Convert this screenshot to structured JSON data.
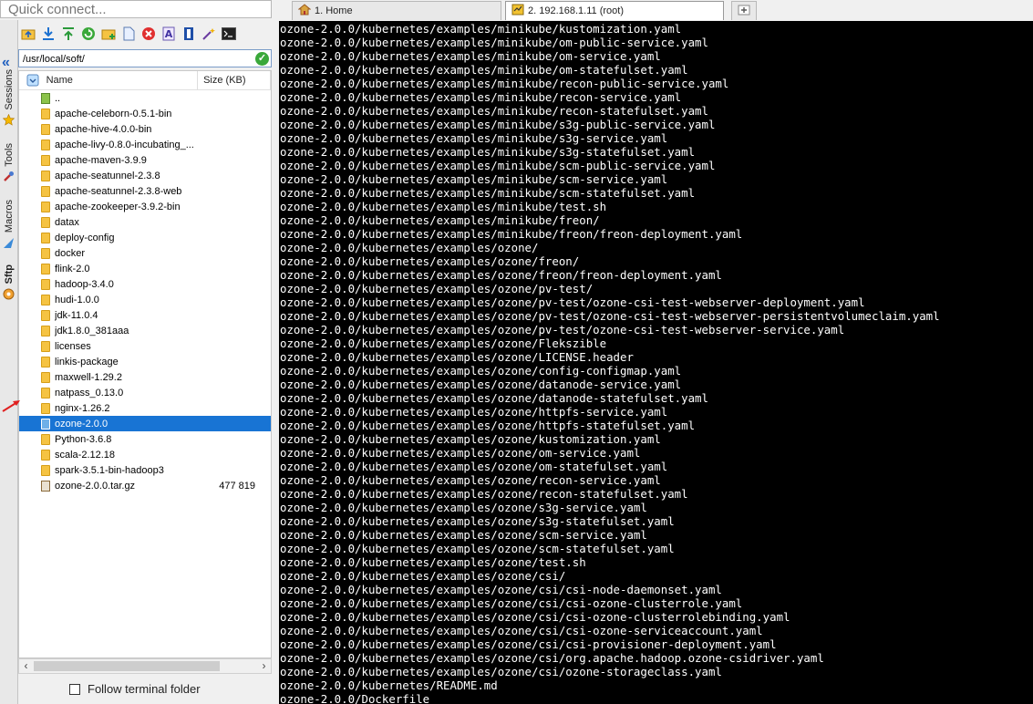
{
  "quick_connect": {
    "placeholder": "Quick connect..."
  },
  "tabs": [
    {
      "label": "1. Home",
      "icon": "home-icon"
    },
    {
      "label": "2. 192.168.1.11 (root)",
      "icon": "ssh-icon"
    }
  ],
  "side_tabs": [
    {
      "label": "Sessions",
      "icon": "star-icon"
    },
    {
      "label": "Tools",
      "icon": "tools-icon"
    },
    {
      "label": "Macros",
      "icon": "macro-icon"
    },
    {
      "label": "Sftp",
      "icon": "sftp-icon"
    }
  ],
  "sftp": {
    "path": "/usr/local/soft/",
    "columns": {
      "name": "Name",
      "size": "Size (KB)"
    },
    "files": [
      {
        "name": "..",
        "type": "up",
        "size": ""
      },
      {
        "name": "apache-celeborn-0.5.1-bin",
        "type": "folder",
        "size": ""
      },
      {
        "name": "apache-hive-4.0.0-bin",
        "type": "folder",
        "size": ""
      },
      {
        "name": "apache-livy-0.8.0-incubating_...",
        "type": "folder",
        "size": ""
      },
      {
        "name": "apache-maven-3.9.9",
        "type": "folder",
        "size": ""
      },
      {
        "name": "apache-seatunnel-2.3.8",
        "type": "folder",
        "size": ""
      },
      {
        "name": "apache-seatunnel-2.3.8-web",
        "type": "folder",
        "size": ""
      },
      {
        "name": "apache-zookeeper-3.9.2-bin",
        "type": "folder",
        "size": ""
      },
      {
        "name": "datax",
        "type": "folder",
        "size": ""
      },
      {
        "name": "deploy-config",
        "type": "folder",
        "size": ""
      },
      {
        "name": "docker",
        "type": "folder",
        "size": ""
      },
      {
        "name": "flink-2.0",
        "type": "folder",
        "size": ""
      },
      {
        "name": "hadoop-3.4.0",
        "type": "folder",
        "size": ""
      },
      {
        "name": "hudi-1.0.0",
        "type": "folder",
        "size": ""
      },
      {
        "name": "jdk-11.0.4",
        "type": "folder",
        "size": ""
      },
      {
        "name": "jdk1.8.0_381aaa",
        "type": "folder",
        "size": ""
      },
      {
        "name": "licenses",
        "type": "folder",
        "size": ""
      },
      {
        "name": "linkis-package",
        "type": "folder",
        "size": ""
      },
      {
        "name": "maxwell-1.29.2",
        "type": "folder",
        "size": ""
      },
      {
        "name": "natpass_0.13.0",
        "type": "folder",
        "size": ""
      },
      {
        "name": "nginx-1.26.2",
        "type": "folder",
        "size": ""
      },
      {
        "name": "ozone-2.0.0",
        "type": "folder",
        "size": "",
        "selected": true
      },
      {
        "name": "Python-3.6.8",
        "type": "folder",
        "size": ""
      },
      {
        "name": "scala-2.12.18",
        "type": "folder",
        "size": ""
      },
      {
        "name": "spark-3.5.1-bin-hadoop3",
        "type": "folder",
        "size": ""
      },
      {
        "name": "ozone-2.0.0.tar.gz",
        "type": "archive",
        "size": "477 819"
      }
    ],
    "follow_label": "Follow terminal folder"
  },
  "terminal_lines": [
    "ozone-2.0.0/kubernetes/examples/minikube/kustomization.yaml",
    "ozone-2.0.0/kubernetes/examples/minikube/om-public-service.yaml",
    "ozone-2.0.0/kubernetes/examples/minikube/om-service.yaml",
    "ozone-2.0.0/kubernetes/examples/minikube/om-statefulset.yaml",
    "ozone-2.0.0/kubernetes/examples/minikube/recon-public-service.yaml",
    "ozone-2.0.0/kubernetes/examples/minikube/recon-service.yaml",
    "ozone-2.0.0/kubernetes/examples/minikube/recon-statefulset.yaml",
    "ozone-2.0.0/kubernetes/examples/minikube/s3g-public-service.yaml",
    "ozone-2.0.0/kubernetes/examples/minikube/s3g-service.yaml",
    "ozone-2.0.0/kubernetes/examples/minikube/s3g-statefulset.yaml",
    "ozone-2.0.0/kubernetes/examples/minikube/scm-public-service.yaml",
    "ozone-2.0.0/kubernetes/examples/minikube/scm-service.yaml",
    "ozone-2.0.0/kubernetes/examples/minikube/scm-statefulset.yaml",
    "ozone-2.0.0/kubernetes/examples/minikube/test.sh",
    "ozone-2.0.0/kubernetes/examples/minikube/freon/",
    "ozone-2.0.0/kubernetes/examples/minikube/freon/freon-deployment.yaml",
    "ozone-2.0.0/kubernetes/examples/ozone/",
    "ozone-2.0.0/kubernetes/examples/ozone/freon/",
    "ozone-2.0.0/kubernetes/examples/ozone/freon/freon-deployment.yaml",
    "ozone-2.0.0/kubernetes/examples/ozone/pv-test/",
    "ozone-2.0.0/kubernetes/examples/ozone/pv-test/ozone-csi-test-webserver-deployment.yaml",
    "ozone-2.0.0/kubernetes/examples/ozone/pv-test/ozone-csi-test-webserver-persistentvolumeclaim.yaml",
    "ozone-2.0.0/kubernetes/examples/ozone/pv-test/ozone-csi-test-webserver-service.yaml",
    "ozone-2.0.0/kubernetes/examples/ozone/Flekszible",
    "ozone-2.0.0/kubernetes/examples/ozone/LICENSE.header",
    "ozone-2.0.0/kubernetes/examples/ozone/config-configmap.yaml",
    "ozone-2.0.0/kubernetes/examples/ozone/datanode-service.yaml",
    "ozone-2.0.0/kubernetes/examples/ozone/datanode-statefulset.yaml",
    "ozone-2.0.0/kubernetes/examples/ozone/httpfs-service.yaml",
    "ozone-2.0.0/kubernetes/examples/ozone/httpfs-statefulset.yaml",
    "ozone-2.0.0/kubernetes/examples/ozone/kustomization.yaml",
    "ozone-2.0.0/kubernetes/examples/ozone/om-service.yaml",
    "ozone-2.0.0/kubernetes/examples/ozone/om-statefulset.yaml",
    "ozone-2.0.0/kubernetes/examples/ozone/recon-service.yaml",
    "ozone-2.0.0/kubernetes/examples/ozone/recon-statefulset.yaml",
    "ozone-2.0.0/kubernetes/examples/ozone/s3g-service.yaml",
    "ozone-2.0.0/kubernetes/examples/ozone/s3g-statefulset.yaml",
    "ozone-2.0.0/kubernetes/examples/ozone/scm-service.yaml",
    "ozone-2.0.0/kubernetes/examples/ozone/scm-statefulset.yaml",
    "ozone-2.0.0/kubernetes/examples/ozone/test.sh",
    "ozone-2.0.0/kubernetes/examples/ozone/csi/",
    "ozone-2.0.0/kubernetes/examples/ozone/csi/csi-node-daemonset.yaml",
    "ozone-2.0.0/kubernetes/examples/ozone/csi/csi-ozone-clusterrole.yaml",
    "ozone-2.0.0/kubernetes/examples/ozone/csi/csi-ozone-clusterrolebinding.yaml",
    "ozone-2.0.0/kubernetes/examples/ozone/csi/csi-ozone-serviceaccount.yaml",
    "ozone-2.0.0/kubernetes/examples/ozone/csi/csi-provisioner-deployment.yaml",
    "ozone-2.0.0/kubernetes/examples/ozone/csi/org.apache.hadoop.ozone-csidriver.yaml",
    "ozone-2.0.0/kubernetes/examples/ozone/csi/ozone-storageclass.yaml",
    "ozone-2.0.0/kubernetes/README.md",
    "ozone-2.0.0/Dockerfile"
  ],
  "colors": {
    "selection": "#1874d4",
    "terminal_bg": "#000000",
    "terminal_fg": "#ffffff",
    "annotation_arrow": "#e02020"
  }
}
